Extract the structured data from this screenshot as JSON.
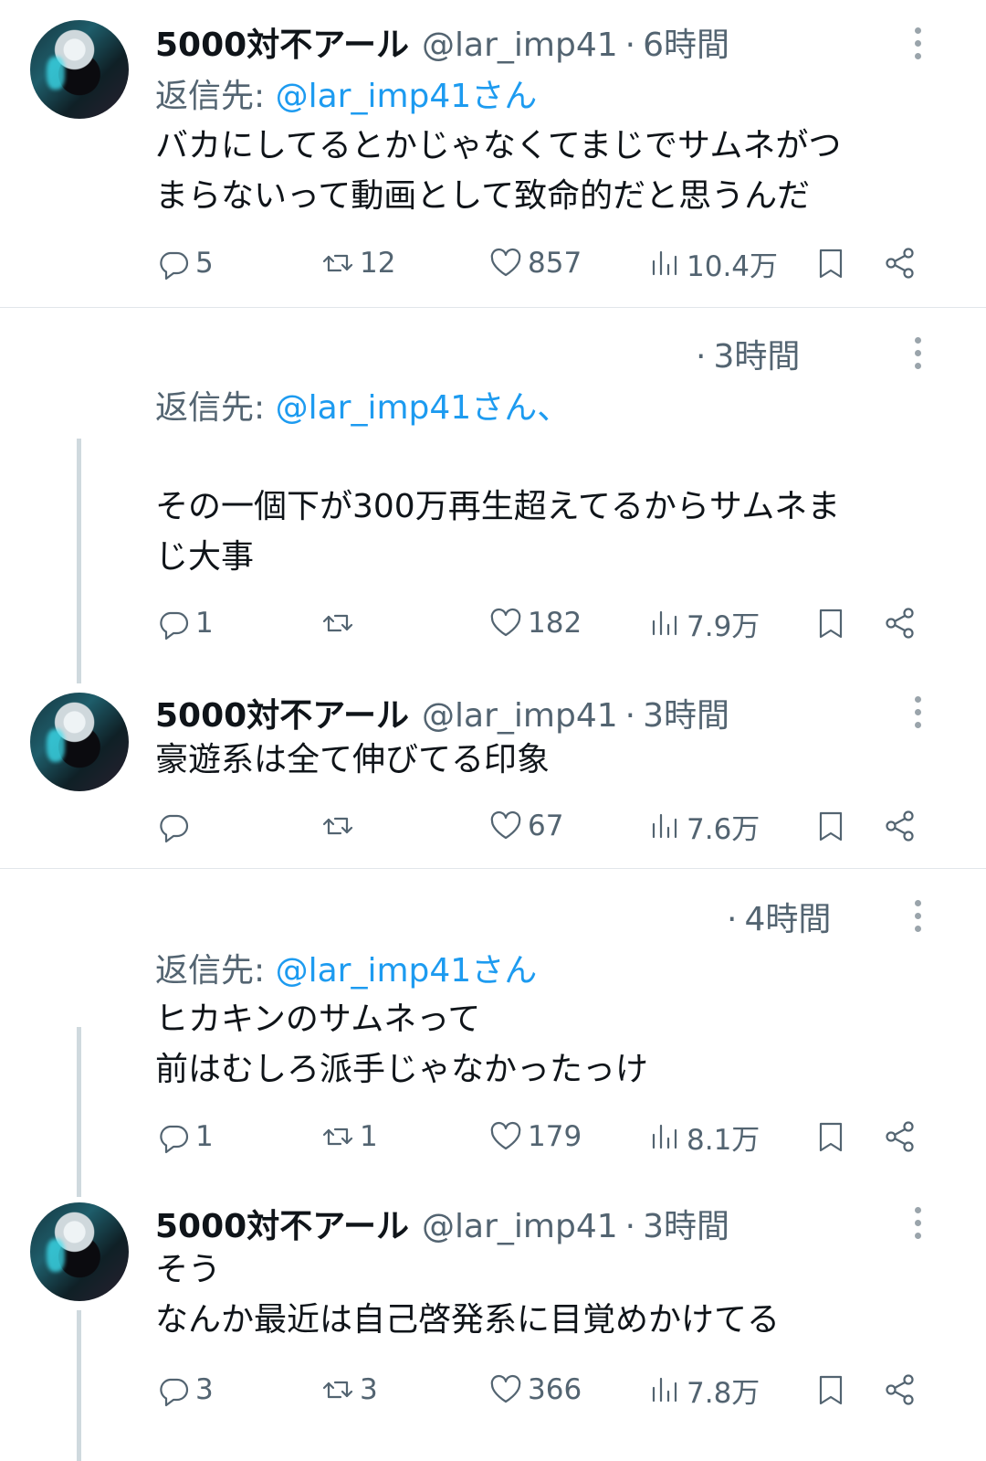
{
  "tweets": [
    {
      "name": "5000対不アール",
      "handle": "@lar_imp41",
      "time": "6時間",
      "reply_label": "返信先:",
      "reply_mention": "@lar_imp41さん",
      "text": "バカにしてるとかじゃなくてまじでサムネがつ\nまらないって動画として致命的だと思うんだ",
      "replies": "5",
      "reposts": "12",
      "likes": "857",
      "views": "10.4万"
    },
    {
      "name": "",
      "handle": "",
      "time": "3時間",
      "reply_label": "返信先:",
      "reply_mention": "@lar_imp41さん、",
      "text": "その一個下が300万再生超えてるからサムネま\nじ大事",
      "replies": "1",
      "reposts": "",
      "likes": "182",
      "views": "7.9万"
    },
    {
      "name": "5000対不アール",
      "handle": "@lar_imp41",
      "time": "3時間",
      "text": "豪遊系は全て伸びてる印象",
      "replies": "",
      "reposts": "",
      "likes": "67",
      "views": "7.6万"
    },
    {
      "name": "",
      "handle": "",
      "time": "4時間",
      "reply_label": "返信先:",
      "reply_mention": "@lar_imp41さん",
      "text": "ヒカキンのサムネって\n前はむしろ派手じゃなかったっけ",
      "replies": "1",
      "reposts": "1",
      "likes": "179",
      "views": "8.1万"
    },
    {
      "name": "5000対不アール",
      "handle": "@lar_imp41",
      "time": "3時間",
      "text": "そう\nなんか最近は自己啓発系に目覚めかけてる",
      "replies": "3",
      "reposts": "3",
      "likes": "366",
      "views": "7.8万"
    }
  ],
  "icons": {
    "reply": "speech-bubble-icon",
    "repost": "repost-arrows-icon",
    "like": "heart-icon",
    "views": "bar-chart-icon",
    "bookmark": "bookmark-icon",
    "share": "share-icon",
    "more": "vertical-dots-icon"
  },
  "colors": {
    "text": "#0f1419",
    "secondary": "#536471",
    "mention": "#1d9bf0",
    "divider": "#e1e6ea"
  }
}
